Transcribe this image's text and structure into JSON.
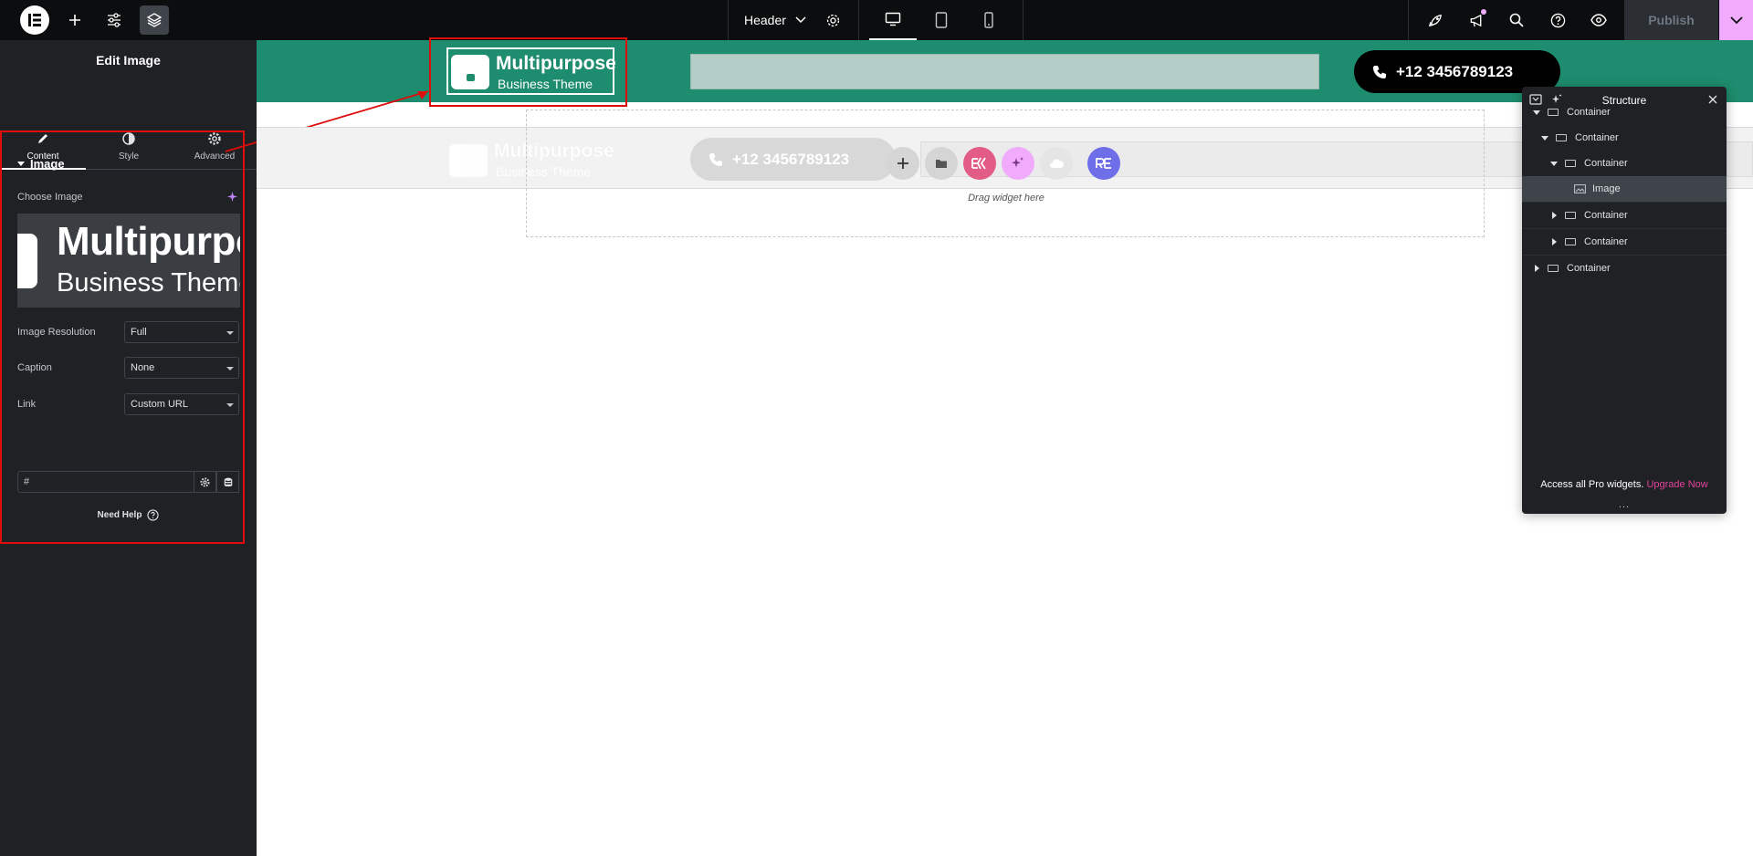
{
  "topbar": {
    "document_title": "Header",
    "publish_label": "Publish",
    "icons": [
      "elementor-logo-icon",
      "add-icon",
      "sliders-icon",
      "layers-icon",
      "settings-icon",
      "desktop-icon",
      "tablet-icon",
      "mobile-icon",
      "rocket-icon",
      "megaphone-icon",
      "search-icon",
      "help-icon",
      "eye-icon",
      "chevron-down-icon"
    ]
  },
  "panel": {
    "title": "Edit Image",
    "tabs": [
      {
        "label": "Content",
        "icon": "pencil-icon",
        "active": true
      },
      {
        "label": "Style",
        "icon": "half-circle-icon",
        "active": false
      },
      {
        "label": "Advanced",
        "icon": "gear-icon",
        "active": false
      }
    ],
    "section_title": "Image",
    "choose_image_label": "Choose Image",
    "preview_text_line1": "Multipurpose",
    "preview_text_line2": "Business Theme",
    "controls": [
      {
        "label": "Image Resolution",
        "value": "Full"
      },
      {
        "label": "Caption",
        "value": "None"
      },
      {
        "label": "Link",
        "value": "Custom URL"
      }
    ],
    "url_value": "#",
    "need_help": "Need Help"
  },
  "canvas": {
    "logo_line1": "Multipurpose",
    "logo_line2": "Business Theme",
    "phone": "+12 3456789123",
    "ghost_phone": "+12 3456789123",
    "drag_widget": "Drag widget here",
    "accent_color": "#1e8c6e",
    "add_buttons": [
      {
        "name": "add-element-button",
        "glyph": "+",
        "color": "#d5d5d5"
      },
      {
        "name": "template-library-button",
        "glyph": "▬",
        "color": "#d5d5d5"
      },
      {
        "name": "elementskit-button",
        "glyph": "EK",
        "color": "#e25c85"
      },
      {
        "name": "ai-button",
        "glyph": "✦",
        "color": "#f0abfc"
      },
      {
        "name": "kit-button",
        "glyph": "◔",
        "color": "#e5e5e5"
      },
      {
        "name": "re-button",
        "glyph": "RE",
        "color": "#6d6ee8"
      }
    ]
  },
  "structure": {
    "title": "Structure",
    "items": [
      {
        "label": "Container",
        "depth": 0,
        "expanded": true,
        "icon": "container-icon"
      },
      {
        "label": "Container",
        "depth": 1,
        "expanded": true,
        "icon": "container-icon"
      },
      {
        "label": "Container",
        "depth": 2,
        "expanded": true,
        "icon": "container-icon"
      },
      {
        "label": "Image",
        "depth": 3,
        "selected": true,
        "icon": "image-icon"
      },
      {
        "label": "Container",
        "depth": 2,
        "expanded": false,
        "icon": "container-icon"
      },
      {
        "label": "Container",
        "depth": 2,
        "expanded": false,
        "icon": "container-icon"
      },
      {
        "label": "Container",
        "depth": 0,
        "expanded": false,
        "icon": "container-icon"
      }
    ],
    "promo_text": "Access all Pro widgets.",
    "promo_link": "Upgrade Now",
    "grip": "..."
  }
}
